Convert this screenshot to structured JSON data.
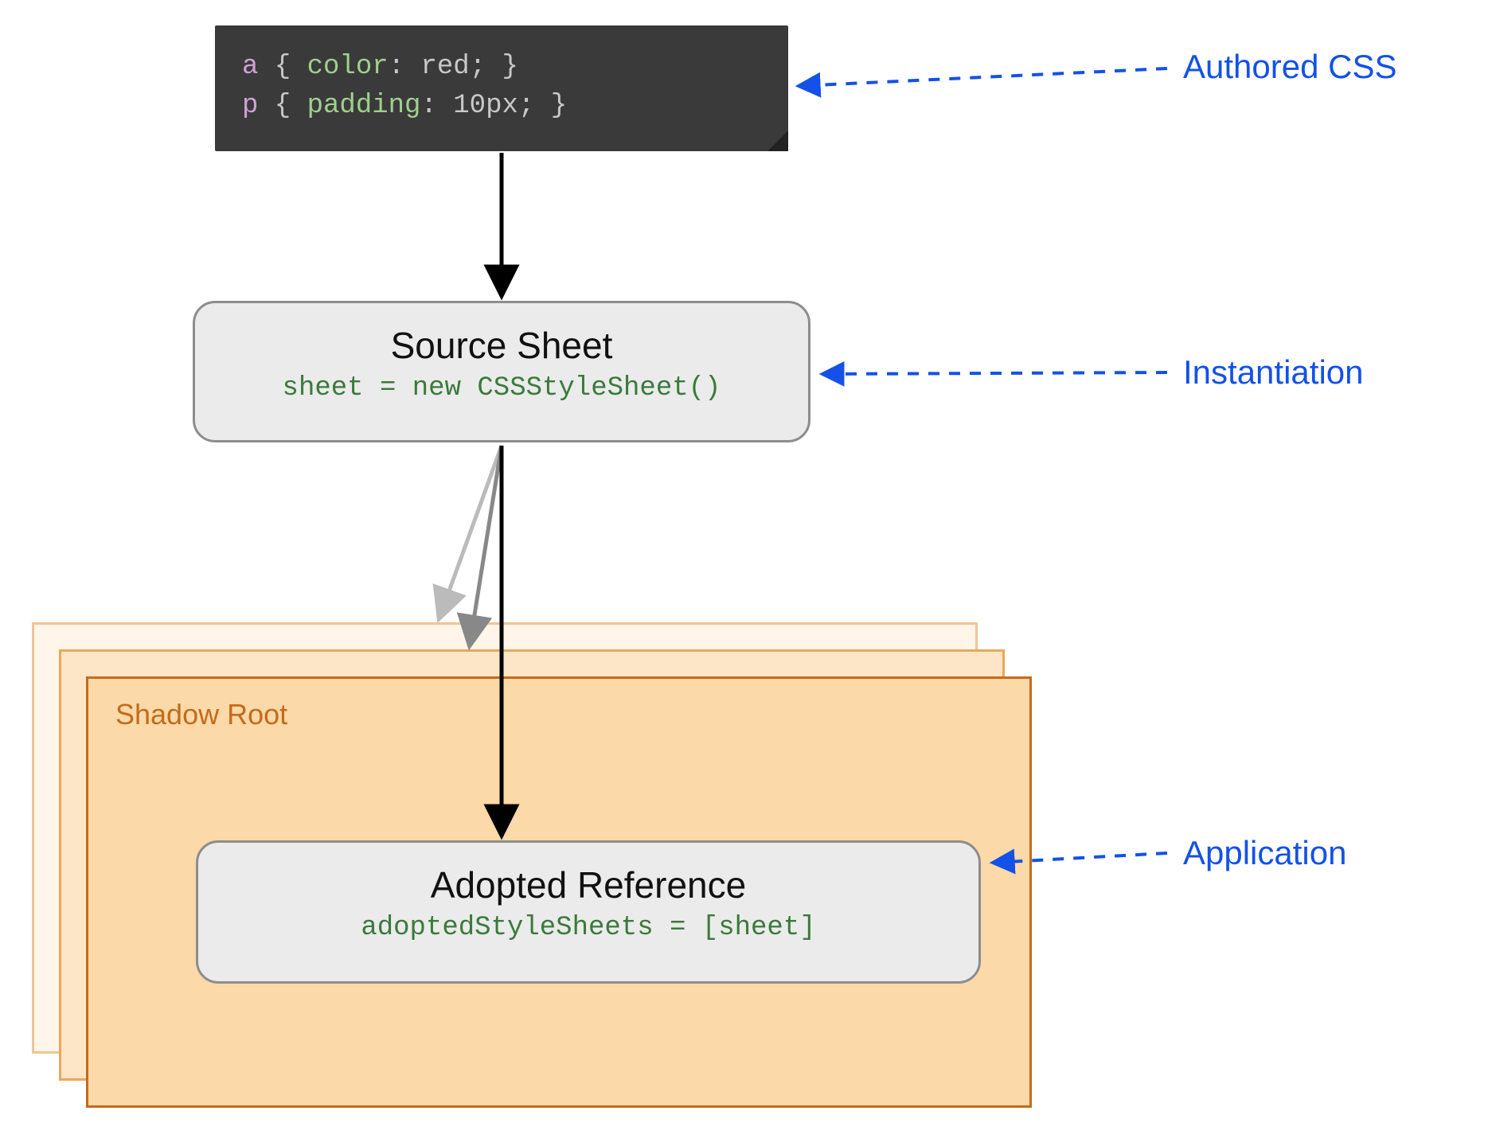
{
  "code": {
    "line1": {
      "selector": "a",
      "open": " { ",
      "property": "color",
      "colon": ": ",
      "value": "red",
      "close": "; }"
    },
    "line2": {
      "selector": "p",
      "open": " { ",
      "property": "padding",
      "colon": ": ",
      "value": "10px",
      "close": "; }"
    }
  },
  "source": {
    "title": "Source Sheet",
    "code": "sheet = new CSSStyleSheet()"
  },
  "shadow": {
    "label": "Shadow Root"
  },
  "adopted": {
    "title": "Adopted Reference",
    "code": "adoptedStyleSheets = [sheet]"
  },
  "annotations": {
    "authored": "Authored CSS",
    "instantiation": "Instantiation",
    "application": "Application"
  },
  "colors": {
    "arrow": "#000000",
    "arrowFaded1": "#888888",
    "arrowFaded2": "#bbbbbb",
    "annotationLine": "#1351e8",
    "shadowBorder": "#c46b1c"
  }
}
